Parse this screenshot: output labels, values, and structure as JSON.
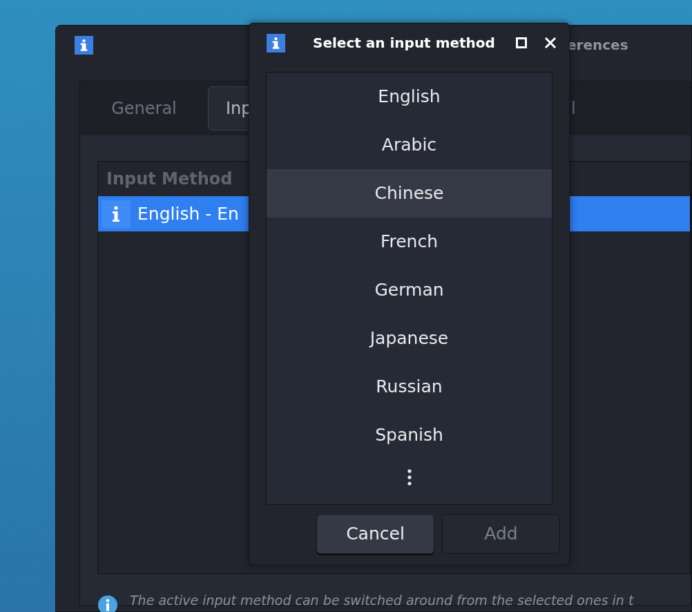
{
  "main_window": {
    "title": "erences",
    "tabs": [
      {
        "label": "General",
        "selected": false
      },
      {
        "label": "Inp",
        "selected": true
      },
      {
        "label": "l",
        "selected": false
      }
    ],
    "list": {
      "column": "Input Method",
      "rows": [
        {
          "label": "English - En",
          "selected": true
        }
      ]
    },
    "info": "The active input method can be switched around from the selected ones in t"
  },
  "dialog": {
    "title": "Select an input method",
    "items": [
      {
        "label": "English",
        "selected": false
      },
      {
        "label": "Arabic",
        "selected": false
      },
      {
        "label": "Chinese",
        "selected": true
      },
      {
        "label": "French",
        "selected": false
      },
      {
        "label": "German",
        "selected": false
      },
      {
        "label": "Japanese",
        "selected": false
      },
      {
        "label": "Russian",
        "selected": false
      },
      {
        "label": "Spanish",
        "selected": false
      }
    ],
    "buttons": [
      {
        "label": "Cancel",
        "disabled": false
      },
      {
        "label": "Add",
        "disabled": true
      }
    ]
  }
}
